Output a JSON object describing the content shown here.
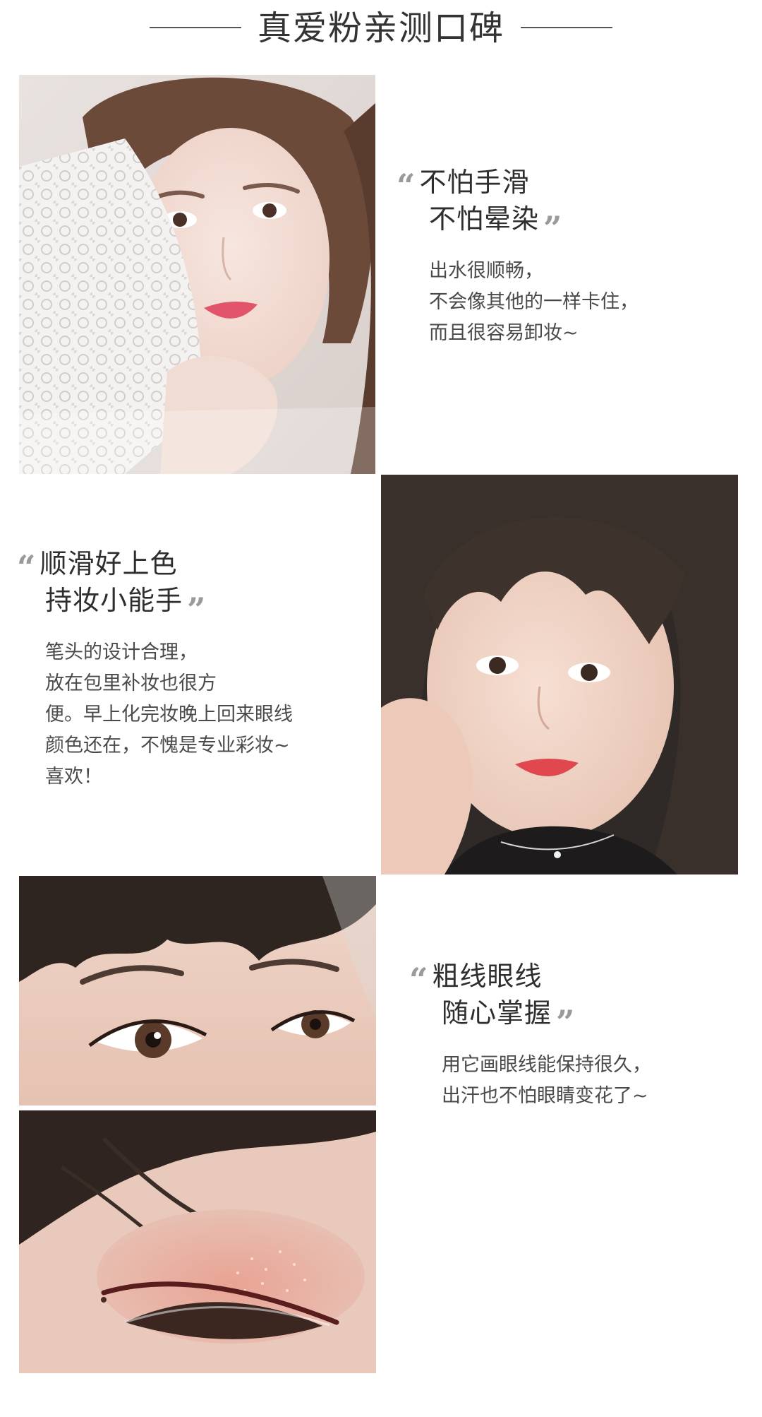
{
  "header": {
    "title": "真爱粉亲测口碑"
  },
  "reviews": [
    {
      "headline": [
        "不怕手滑",
        "不怕晕染"
      ],
      "body": [
        "出水很顺畅，",
        "不会像其他的一样卡住，",
        "而且很容易卸妆~"
      ]
    },
    {
      "headline": [
        "顺滑好上色",
        "持妆小能手"
      ],
      "body": [
        "笔头的设计合理，",
        "放在包里补妆也很方",
        "便。早上化完妆晚上回来眼线",
        "颜色还在，不愧是专业彩妆~",
        "喜欢！"
      ]
    },
    {
      "headline": [
        "粗线眼线",
        "随心掌握"
      ],
      "body": [
        "用它画眼线能保持很久，",
        "出汗也不怕眼睛变花了~"
      ]
    }
  ],
  "quote_marks": {
    "open": "“",
    "close": "”"
  },
  "colors": {
    "quote": "#9a9a9a",
    "headline": "#2e2e2e",
    "body": "#4a4a4a",
    "rule": "#555555"
  },
  "photos": [
    {
      "icon": "portrait-photo-lace-top"
    },
    {
      "icon": "portrait-photo-bangs"
    },
    {
      "icon": "eye-closeup-photo"
    },
    {
      "icon": "eyeliner-closeup-photo"
    }
  ]
}
